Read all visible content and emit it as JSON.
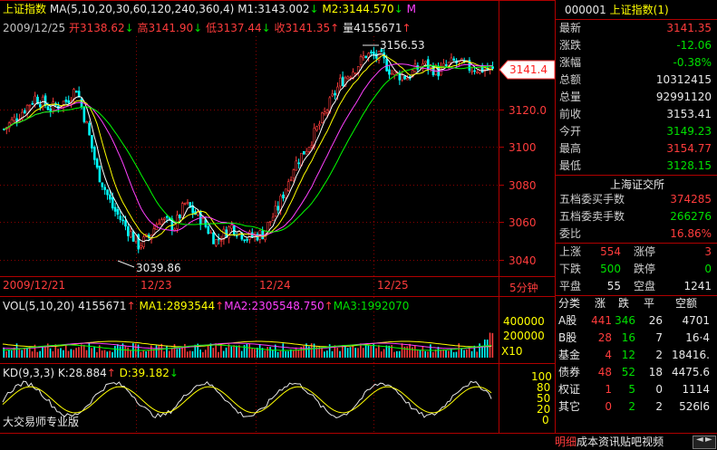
{
  "header": {
    "index_name": "上证指数",
    "ma_label": "MA(5,10,20,30,60,120,240,360,4)",
    "m1": "M1:3143.002",
    "m1_arrow": "↓",
    "m2": "M2:3144.570",
    "m2_arrow": "↓",
    "m3_stub": "M",
    "date": "2009/12/25",
    "open": "开3138.62",
    "open_arrow": "↓",
    "high": "高3141.90",
    "high_arrow": "↓",
    "low": "低3137.44",
    "low_arrow": "↓",
    "close": "收3141.35",
    "close_arrow": "↑",
    "volume": "量4155671",
    "volume_arrow": "↑"
  },
  "annotations": {
    "max_label": "3156.53",
    "min_label": "3039.86",
    "last_price_tag": "3141.4"
  },
  "price_axis": [
    "3120.0",
    "3100",
    "3080",
    "3060",
    "3040"
  ],
  "date_axis": [
    "2009/12/21",
    "12/23",
    "12/24",
    "12/25"
  ],
  "period_label": "5分钟",
  "volume_panel": {
    "label": "VOL(5,10,20)",
    "value": "4155671",
    "value_arrow": "↑",
    "ma1": "MA1:2893544",
    "ma1_arrow": "↑",
    "ma2": "MA2:2305548.750",
    "ma2_arrow": "↑",
    "ma3": "MA3:1992070",
    "axis": [
      "400000",
      "200000",
      "X10"
    ]
  },
  "kd_panel": {
    "label": "KD(9,3,3)",
    "k": "K:28.884",
    "k_arrow": "↑",
    "d": "D:39.182",
    "d_arrow": "↓",
    "axis": [
      "100",
      "80",
      "50",
      "20",
      "0"
    ]
  },
  "watermark": "大交易师专业版",
  "panel": {
    "code": "000001",
    "name": "上证指数(1)",
    "quotes": [
      {
        "label": "最新",
        "value": "3141.35",
        "color": "#ff3c3c"
      },
      {
        "label": "涨跌",
        "value": "-12.06",
        "color": "#00e000"
      },
      {
        "label": "涨幅",
        "value": "-0.38%",
        "color": "#00e000"
      },
      {
        "label": "总额",
        "value": "10312415",
        "color": "#e8e8e8"
      },
      {
        "label": "总量",
        "value": "92991120",
        "color": "#e8e8e8"
      },
      {
        "label": "前收",
        "value": "3153.41",
        "color": "#e8e8e8"
      },
      {
        "label": "今开",
        "value": "3149.23",
        "color": "#00e000"
      },
      {
        "label": "最高",
        "value": "3154.77",
        "color": "#ff3c3c"
      },
      {
        "label": "最低",
        "value": "3128.15",
        "color": "#00e000"
      }
    ],
    "exchange": "上海证交所",
    "orders": [
      {
        "label": "五档委买手数",
        "value": "374285",
        "color": "#ff3c3c"
      },
      {
        "label": "五档委卖手数",
        "value": "266276",
        "color": "#00e000"
      },
      {
        "label": "委比",
        "value": "16.86%",
        "color": "#ff3c3c"
      }
    ],
    "breadth": [
      {
        "l1": "上涨",
        "v1": "554",
        "c1": "#ff3c3c",
        "l2": "涨停",
        "v2": "3",
        "c2": "#ff3c3c"
      },
      {
        "l1": "下跌",
        "v1": "500",
        "c1": "#00e000",
        "l2": "跌停",
        "v2": "0",
        "c2": "#00e000"
      },
      {
        "l1": "平盘",
        "v1": "55",
        "c1": "#e8e8e8",
        "l2": "空盘",
        "v2": "1241",
        "c2": "#e8e8e8"
      }
    ],
    "category_header": [
      "分类",
      "涨",
      "跌",
      "平",
      "空额"
    ],
    "categories": [
      {
        "name": "A股",
        "up": "441",
        "down": "346",
        "flat": "26",
        "empty": "4701"
      },
      {
        "name": "B股",
        "up": "28",
        "down": "16",
        "flat": "7",
        "empty": "16·4"
      },
      {
        "name": "基金",
        "up": "4",
        "down": "12",
        "flat": "2",
        "empty": "18416."
      },
      {
        "name": "债券",
        "up": "48",
        "down": "52",
        "flat": "18",
        "empty": "4475.6"
      },
      {
        "name": "权证",
        "up": "1",
        "down": "5",
        "flat": "0",
        "empty": "1114"
      },
      {
        "name": "其它",
        "up": "0",
        "down": "2",
        "flat": "2",
        "empty": "526l6"
      }
    ]
  },
  "bottom_tabs": [
    "明细",
    "成本",
    "资讯",
    "贴吧",
    "视频"
  ],
  "colors": {
    "up": "#ff3c3c",
    "down": "#00e000",
    "frame": "#b00000",
    "ma1": "#ffffff",
    "ma2": "#ffff00",
    "ma3": "#ff40ff",
    "ma4": "#00ff00"
  }
}
